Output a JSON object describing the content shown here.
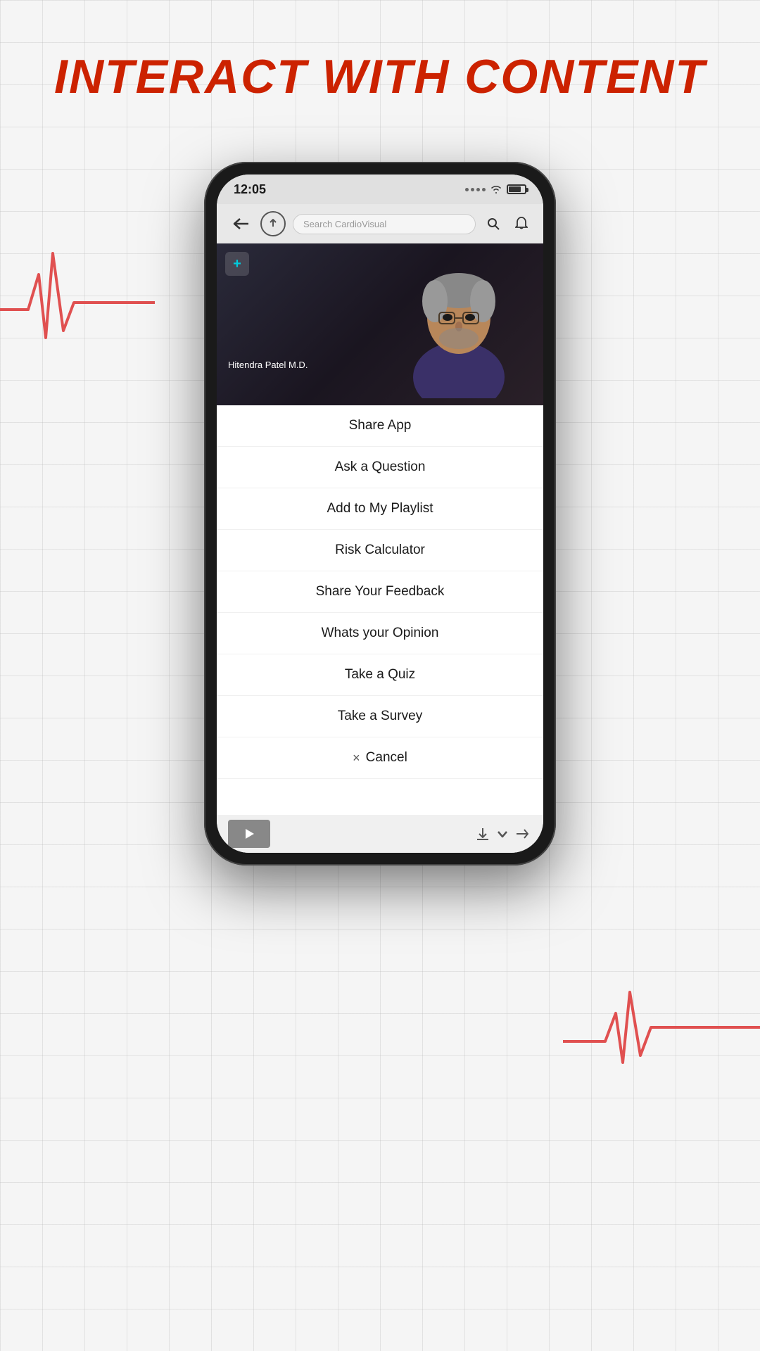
{
  "page": {
    "title": "INTERACT WITH CONTENT",
    "bg_color": "#f5f5f5",
    "accent_color": "#cc2200"
  },
  "status_bar": {
    "time": "12:05",
    "signal_dots": 4,
    "wifi_label": "wifi",
    "battery_percent": 70
  },
  "nav_bar": {
    "search_placeholder": "Search CardioVisual",
    "back_label": "back",
    "upload_label": "upload",
    "search_label": "search",
    "bell_label": "bell"
  },
  "video": {
    "doctor_name": "Hitendra Patel M.D.",
    "logo_label": "CardioVisual logo"
  },
  "menu": {
    "items": [
      {
        "id": "share-app",
        "label": "Share App"
      },
      {
        "id": "ask-question",
        "label": "Ask a Question"
      },
      {
        "id": "add-playlist",
        "label": "Add to My Playlist"
      },
      {
        "id": "risk-calculator",
        "label": "Risk Calculator"
      },
      {
        "id": "share-feedback",
        "label": "Share Your Feedback"
      },
      {
        "id": "opinion",
        "label": "Whats your Opinion"
      },
      {
        "id": "take-quiz",
        "label": "Take a Quiz"
      },
      {
        "id": "take-survey",
        "label": "Take a Survey"
      }
    ],
    "cancel_label": "Cancel",
    "cancel_icon": "×"
  }
}
